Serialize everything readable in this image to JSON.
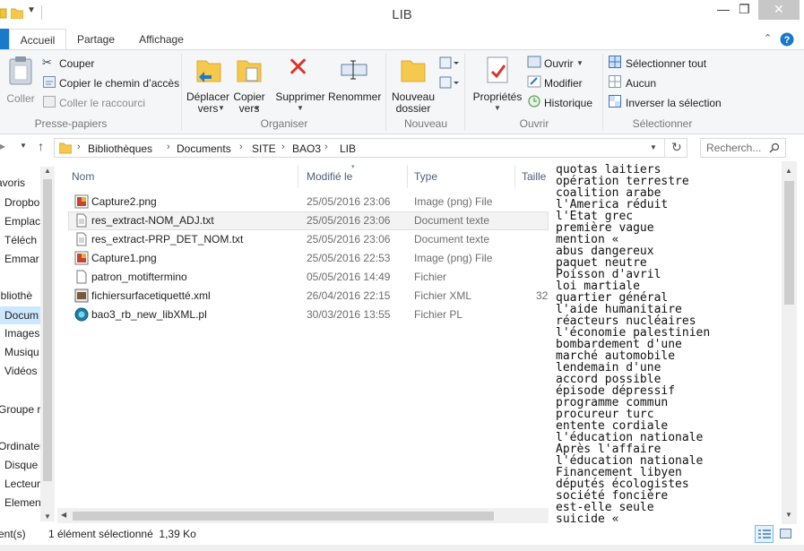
{
  "window": {
    "title": "LIB"
  },
  "tabs": [
    {
      "label": "Accueil"
    },
    {
      "label": "Partage"
    },
    {
      "label": "Affichage"
    }
  ],
  "ribbon": {
    "clipboard": {
      "paste": "Coller",
      "cut": "Couper",
      "copy_path": "Copier le chemin d’accès",
      "paste_shortcut": "Coller le raccourci",
      "group_label": "Presse-papiers"
    },
    "organize": {
      "move_to": "Déplacer vers",
      "copy_to": "Copier vers",
      "delete": "Supprimer",
      "rename": "Renommer",
      "group_label": "Organiser"
    },
    "new": {
      "new_folder": "Nouveau dossier",
      "group_label": "Nouveau"
    },
    "open": {
      "properties": "Propriétés",
      "open": "Ouvrir",
      "edit": "Modifier",
      "history": "Historique",
      "group_label": "Ouvrir"
    },
    "select": {
      "select_all": "Sélectionner tout",
      "select_none": "Aucun",
      "invert": "Inverser la sélection",
      "group_label": "Sélectionner"
    }
  },
  "address": {
    "crumbs": [
      "Bibliothèques",
      "Documents",
      "SITE",
      "BAO3",
      "LIB"
    ],
    "search_placeholder": "Recherch..."
  },
  "nav": [
    {
      "label": "avoris"
    },
    {
      "label": "Dropbo"
    },
    {
      "label": "Emplac"
    },
    {
      "label": "Téléch"
    },
    {
      "label": "Emmar"
    },
    {
      "label": "ibliothè"
    },
    {
      "label": "Docum"
    },
    {
      "label": "Images"
    },
    {
      "label": "Musiqu"
    },
    {
      "label": "Vidéos"
    },
    {
      "label": "Groupe re"
    },
    {
      "label": "Ordinateu"
    },
    {
      "label": "Disque"
    },
    {
      "label": "Lecteur"
    },
    {
      "label": "Elemen"
    }
  ],
  "columns": {
    "name": "Nom",
    "modified": "Modifié le",
    "type": "Type",
    "size": "Taille"
  },
  "files": [
    {
      "name": "Capture2.png",
      "modified": "25/05/2016 23:06",
      "type": "Image (png) File",
      "size": "",
      "icon": "png-image-icon"
    },
    {
      "name": "res_extract-NOM_ADJ.txt",
      "modified": "25/05/2016 23:06",
      "type": "Document texte",
      "size": "",
      "icon": "text-file-icon",
      "selected": true
    },
    {
      "name": "res_extract-PRP_DET_NOM.txt",
      "modified": "25/05/2016 23:06",
      "type": "Document texte",
      "size": "",
      "icon": "text-file-icon"
    },
    {
      "name": "Capture1.png",
      "modified": "25/05/2016 22:53",
      "type": "Image (png) File",
      "size": "",
      "icon": "png-image-icon"
    },
    {
      "name": "patron_motiftermino",
      "modified": "05/05/2016 14:49",
      "type": "Fichier",
      "size": "",
      "icon": "blank-file-icon"
    },
    {
      "name": "fichiersurfacetiquetté.xml",
      "modified": "26/04/2016 22:15",
      "type": "Fichier XML",
      "size": "32",
      "icon": "xml-file-icon"
    },
    {
      "name": "bao3_rb_new_libXML.pl",
      "modified": "30/03/2016 13:55",
      "type": "Fichier PL",
      "size": "",
      "icon": "perl-file-icon"
    }
  ],
  "text_lines": [
    "quotas laitiers",
    "opération terrestre",
    "coalition arabe",
    "l'America réduit",
    "l'Etat grec",
    "première vague",
    "mention «",
    "abus dangereux",
    "paquet neutre",
    "Poisson d'avril",
    "loi martiale",
    "quartier général",
    "l'aide humanitaire",
    "réacteurs nucléaires",
    "l'économie palestinien",
    "bombardement d'une",
    "marché automobile",
    "lendemain d'une",
    "accord possible",
    "épisode dépressif",
    "programme commun",
    "procureur turc",
    "entente cordiale",
    "l'éducation nationale",
    "Après l'affaire",
    "l'éducation nationale",
    "Financement libyen",
    "députés écologistes",
    "société foncière",
    "est-elle seule",
    "suicide «"
  ],
  "status": {
    "items_count": "ent(s)",
    "selection": "1 élément sélectionné  1,39 Ko"
  },
  "colors": {
    "accent": "#1979ca",
    "selection": "#cce8ff",
    "header_text": "#4c607a"
  }
}
